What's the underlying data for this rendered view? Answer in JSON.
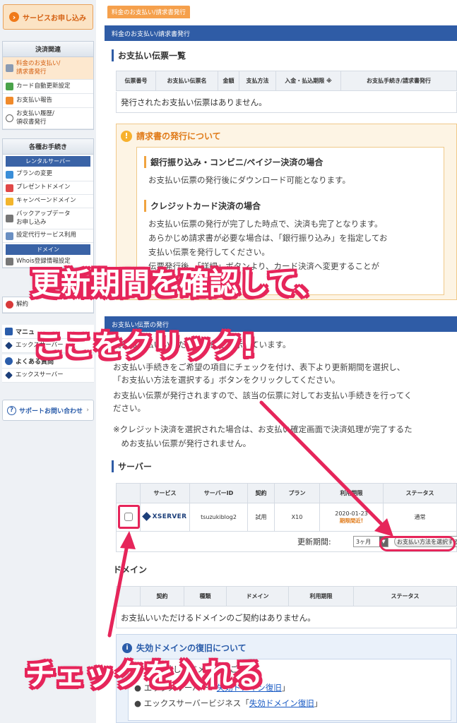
{
  "sidebar": {
    "apply_button": "サービスお申し込み",
    "payment_section": {
      "title": "決済関連",
      "items": [
        {
          "label1": "料金のお支払い/",
          "label2": "請求書発行"
        },
        {
          "label1": "カード自動更新設定",
          "label2": ""
        },
        {
          "label1": "お支払い報告",
          "label2": ""
        },
        {
          "label1": "お支払い履歴/",
          "label2": "領収書発行"
        }
      ]
    },
    "procedures": {
      "title": "各種お手続き",
      "rental_sub": "レンタルサーバー",
      "items": [
        {
          "label1": "プランの変更",
          "label2": ""
        },
        {
          "label1": "プレゼントドメイン",
          "label2": ""
        },
        {
          "label1": "キャンペーンドメイン",
          "label2": ""
        },
        {
          "label1": "バックアップデータ",
          "label2": "お申し込み"
        },
        {
          "label1": "設定代行サービス利用",
          "label2": ""
        }
      ],
      "domain_sub": "ドメイン",
      "domain_item": "Whois登録情報設定"
    },
    "cancel_item": "解約",
    "manual_title": "マニュ",
    "manual_item": "エックスサーバー",
    "faq_title": "よくある質問",
    "faq_item": "エックスサーバー",
    "support": "サポートお問い合わせ"
  },
  "main": {
    "tab": "料金のお支払い/請求書発行",
    "header_bar": "料金のお支払い/請求書発行",
    "invoice_section": {
      "title": "お支払い伝票一覧",
      "columns": [
        "伝票番号",
        "お支払い伝票名",
        "金額",
        "支払方法",
        "入金・払込期限 ※",
        "お支払手続き/請求書発行"
      ],
      "empty": "発行されたお支払い伝票はありません。"
    },
    "notice": {
      "title": "請求書の発行について",
      "bank_heading": "銀行振り込み・コンビニ/ペイジー決済の場合",
      "bank_text": "お支払い伝票の発行後にダウンロード可能となります。",
      "card_heading": "クレジットカード決済の場合",
      "card_lines": [
        "お支払い伝票の発行が完了した時点で、決済も完了となります。",
        "あらかじめ請求書が必要な場合は、「銀行振り込み」を指定してお",
        "支払い伝票を発行してください。",
        "伝票発行後、「詳細」ボタンより、カード決済へ変更することが"
      ]
    },
    "issue_bar": "お支払い伝票の発行",
    "issue_lines": [
      "現在お支払いいただける契約を表示しています。",
      "お支払い手続きをご希望の項目にチェックを付け、表下より更新期間を選択し、",
      "「お支払い方法を選択する」ボタンをクリックしてください。",
      "お支払い伝票が発行されますので、該当の伝票に対してお支払い手続きを行ってく",
      "ださい。"
    ],
    "credit_note_lines": [
      "※クレジット決済を選択された場合は、お支払い確定画面で決済処理が完了するた",
      "　めお支払い伝票が発行されません。"
    ],
    "server_section": {
      "title": "サーバー",
      "columns": [
        "",
        "サービス",
        "サーバーID",
        "契約",
        "プラン",
        "利用期限",
        "ステータス"
      ],
      "row": {
        "service_logo": "XSERVER",
        "server_id": "tsuzukiblog2",
        "contract": "試用",
        "plan": "X10",
        "expiry": "2020-01-23",
        "expiry_note": "期限間近!",
        "status": "通常"
      },
      "renew_label": "更新期間:",
      "renew_value": "3ヶ月",
      "pay_button": "お支払い方法を選択する"
    },
    "domain_section": {
      "title": "ドメイン",
      "columns": [
        "",
        "契約",
        "種類",
        "ドメイン",
        "利用期限",
        "ステータス"
      ],
      "empty": "お支払いいただけるドメインのご契約はありません。"
    },
    "info": {
      "title": "失効ドメインの復旧について",
      "line1": "失効したドメインのご案内",
      "bullet1_prefix": "エックスサーバー「",
      "bullet1_link": "失効ドメイン復旧",
      "bullet1_suffix": "」",
      "bullet2_prefix": "エックスサーバービジネス「",
      "bullet2_link": "失効ドメイン復旧",
      "bullet2_suffix": "」"
    }
  },
  "annotations": {
    "caption1": "更新期間を確認して、",
    "caption2": "ここをクリック!",
    "caption3": "チェックを入れる",
    "color": "#e6255a"
  }
}
